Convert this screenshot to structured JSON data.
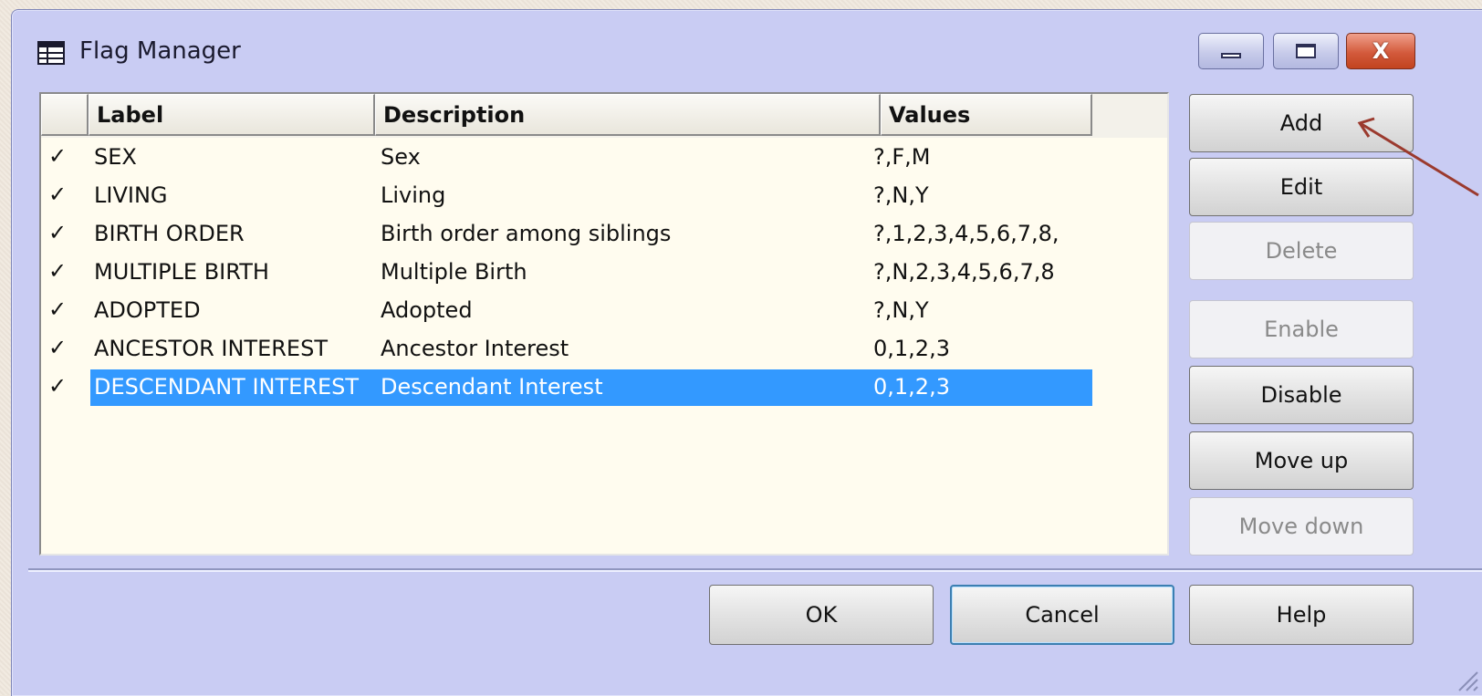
{
  "window": {
    "title": "Flag Manager",
    "icon": "table-icon",
    "minimize_icon": "minimize-icon",
    "maximize_icon": "maximize-icon",
    "close_icon": "close-icon",
    "close_glyph": "X"
  },
  "list": {
    "columns": {
      "label": "Label",
      "description": "Description",
      "values": "Values"
    },
    "check_glyph": "✓",
    "rows": [
      {
        "label": "SEX",
        "description": "Sex",
        "values": "?,F,M",
        "enabled": true
      },
      {
        "label": "LIVING",
        "description": "Living",
        "values": "?,N,Y",
        "enabled": true
      },
      {
        "label": "BIRTH ORDER",
        "description": "Birth order among siblings",
        "values": "?,1,2,3,4,5,6,7,8,",
        "enabled": true
      },
      {
        "label": "MULTIPLE BIRTH",
        "description": "Multiple Birth",
        "values": "?,N,2,3,4,5,6,7,8",
        "enabled": true
      },
      {
        "label": "ADOPTED",
        "description": "Adopted",
        "values": "?,N,Y",
        "enabled": true
      },
      {
        "label": "ANCESTOR INTEREST",
        "description": "Ancestor Interest",
        "values": "0,1,2,3",
        "enabled": true
      },
      {
        "label": "DESCENDANT INTEREST",
        "description": "Descendant Interest",
        "values": "0,1,2,3",
        "enabled": true,
        "selected": true
      }
    ]
  },
  "side_buttons": {
    "add": "Add",
    "edit": "Edit",
    "delete": "Delete",
    "enable": "Enable",
    "disable": "Disable",
    "move_up": "Move up",
    "move_down": "Move down"
  },
  "bottom_buttons": {
    "ok": "OK",
    "cancel": "Cancel",
    "help": "Help"
  },
  "colors": {
    "selection": "#3399ff",
    "dialog_bg": "#c9ccf3",
    "list_bg": "#fffcef",
    "annotation_arrow": "#9b3a2e"
  }
}
